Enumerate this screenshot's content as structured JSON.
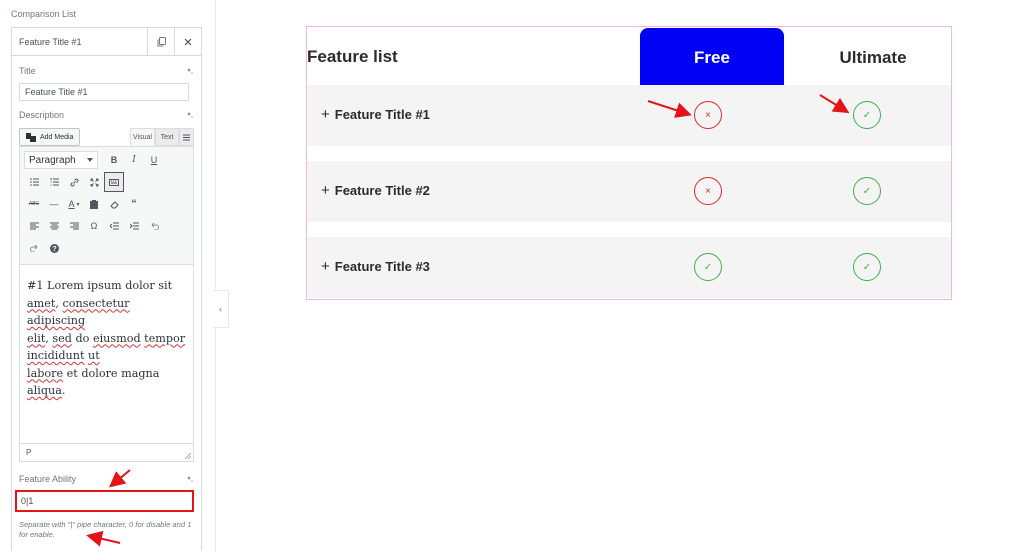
{
  "panel": {
    "heading": "Comparison List",
    "item_title": "Feature Title #1",
    "title_label": "Title",
    "title_value": "Feature Title #1",
    "description_label": "Description",
    "add_media_label": "Add Media",
    "tab_visual": "Visual",
    "tab_text": "Text",
    "format_value": "Paragraph",
    "description_lines": [
      [
        "#1 Lorem ipsum dolor sit"
      ],
      [
        "amet, consectetur adipiscing"
      ],
      [
        "elit, sed do eiusmod tempor"
      ],
      [
        "incididunt ut"
      ],
      [
        "labore et dolore magna aliqua."
      ]
    ],
    "path_label": "P",
    "ability_label": "Feature Ability",
    "ability_value": "0|1",
    "ability_help": "Separate with \"|\" pipe character, 0 for disable and 1 for enable."
  },
  "preview": {
    "header_title": "Feature list",
    "column_free": "Free",
    "column_ultimate": "Ultimate",
    "rows": [
      {
        "title": "Feature Title #1",
        "free": false,
        "ultimate": true
      },
      {
        "title": "Feature Title #2",
        "free": false,
        "ultimate": true
      },
      {
        "title": "Feature Title #3",
        "free": true,
        "ultimate": true
      }
    ],
    "accent": "#0000f5",
    "cross_color": "#e02b2b",
    "check_color": "#43b04a",
    "annotation_color": "#e3151b"
  },
  "icons": {
    "plus": "+",
    "cross": "×",
    "check": "✓"
  }
}
